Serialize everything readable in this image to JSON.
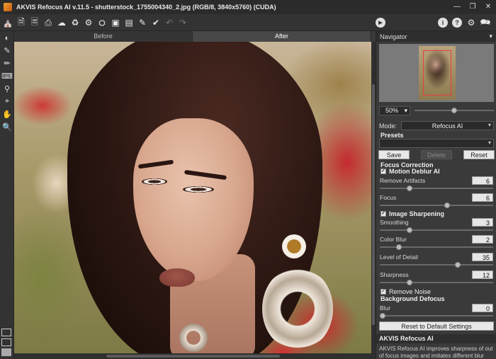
{
  "window": {
    "title": "AKVIS Refocus AI v.11.5 - shutterstock_1755004340_2.jpg (RGB/8, 3840x5760) (CUDA)"
  },
  "toolbar": {
    "left_icons": [
      "home-icon",
      "open-file-icon",
      "save-file-icon",
      "print-icon",
      "cloud-upload-icon",
      "batch-icon",
      "settings-gear-icon",
      "preferences-icon",
      "effect-a-icon",
      "effect-b-icon",
      "brush-icon",
      "check-brush-icon",
      "undo-icon",
      "redo-icon"
    ],
    "right_icons": [
      "info-icon",
      "help-icon",
      "gear-icon",
      "notification-icon"
    ]
  },
  "tools": [
    "before-after-tool",
    "focus-brush-tool",
    "eraser-tool",
    "history-brush-tool",
    "stamp-tool",
    "crop-tool",
    "hand-tool",
    "zoom-tool"
  ],
  "tabs": [
    {
      "label": "Before",
      "active": false
    },
    {
      "label": "After",
      "active": true
    }
  ],
  "navigator": {
    "title": "Navigator",
    "zoom": "50%",
    "zoom_level": 0.5
  },
  "mode": {
    "label": "Mode:",
    "value": "Refocus AI"
  },
  "presets": {
    "title": "Presets",
    "value": "",
    "save": "Save",
    "delete": "Delete",
    "reset": "Reset"
  },
  "focus_correction": {
    "title": "Focus Correction",
    "motion_deblur": "Motion Deblur AI",
    "motion_deblur_checked": true,
    "remove_artifacts": {
      "label": "Remove Artifacts",
      "value": "6",
      "fraction": 0.25
    },
    "focus": {
      "label": "Focus",
      "value": "6",
      "fraction": 0.6
    },
    "image_sharpening": "Image Sharpening",
    "image_sharpening_checked": true,
    "smoothing": {
      "label": "Smoothing",
      "value": "3",
      "fraction": 0.25
    },
    "color_blur": {
      "label": "Color Blur",
      "value": "2",
      "fraction": 0.15
    },
    "level_of_detail": {
      "label": "Level of Detail",
      "value": "35",
      "fraction": 0.7
    },
    "sharpness": {
      "label": "Sharpness",
      "value": "12",
      "fraction": 0.25
    },
    "remove_noise": "Remove Noise",
    "remove_noise_checked": true
  },
  "background_defocus": {
    "title": "Background Defocus",
    "blur": {
      "label": "Blur",
      "value": "0",
      "fraction": 0.0
    }
  },
  "reset_defaults": "Reset to Default Settings",
  "help": {
    "title": "AKVIS Refocus AI",
    "text": "AKVIS Refocus AI improves sharpness of out of focus images and imitates different blur effects."
  },
  "colors": {
    "accent_red": "#e24040",
    "panel_bg": "#3a3a3a"
  }
}
